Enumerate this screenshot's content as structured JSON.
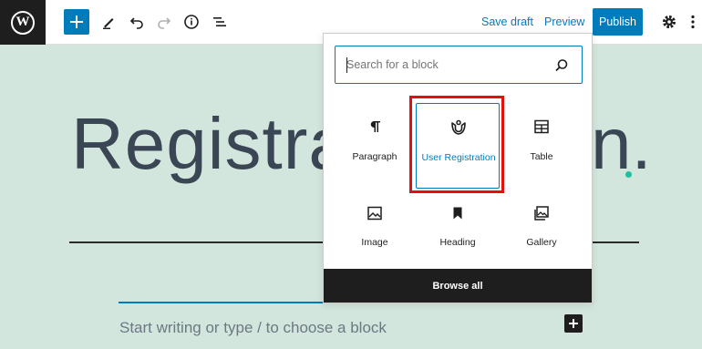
{
  "toolbar": {
    "save_draft": "Save draft",
    "preview": "Preview",
    "publish": "Publish",
    "icons": [
      "wordpress-logo-icon",
      "plus-icon",
      "pencil-icon",
      "undo-icon",
      "redo-icon",
      "info-icon",
      "list-view-icon",
      "gear-icon",
      "more-vertical-icon"
    ]
  },
  "editor": {
    "title_start": "Registrat",
    "title_end": "n.",
    "body_placeholder": "Start writing or type / to choose a block"
  },
  "inserter": {
    "search": {
      "placeholder": "Search for a block",
      "value": ""
    },
    "blocks": [
      {
        "label": "Paragraph",
        "icon": "paragraph-icon"
      },
      {
        "label": "User Registration",
        "icon": "user-registration-icon",
        "highlighted": true
      },
      {
        "label": "Table",
        "icon": "table-icon"
      },
      {
        "label": "Image",
        "icon": "image-icon"
      },
      {
        "label": "Heading",
        "icon": "bookmark-heading-icon"
      },
      {
        "label": "Gallery",
        "icon": "gallery-icon"
      }
    ],
    "browse_all": "Browse all"
  },
  "colors": {
    "accent": "#007cba",
    "highlight": "#e31010",
    "canvas_bg": "#d2e6dd",
    "dark": "#1e1e1e"
  }
}
